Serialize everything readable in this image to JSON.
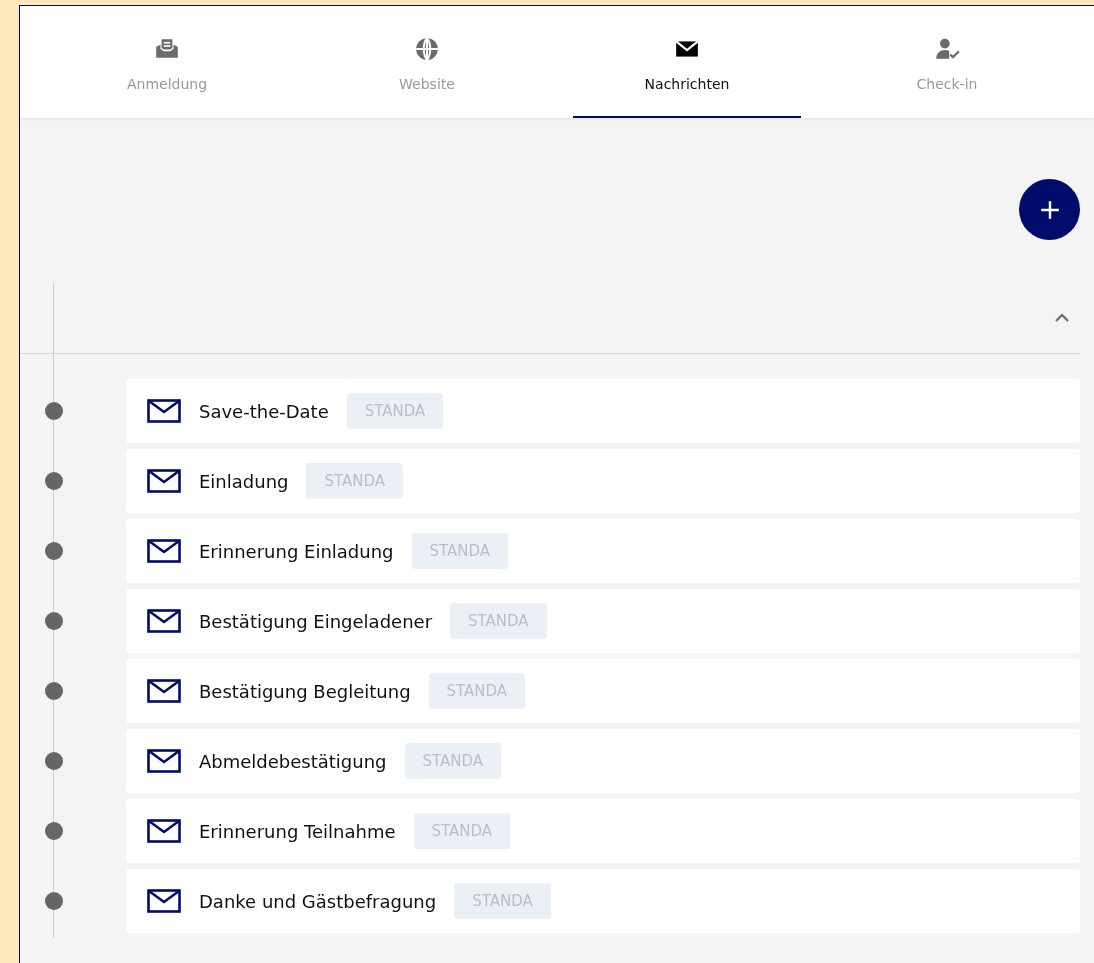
{
  "tabs": [
    {
      "label": "Anmeldung",
      "selected": false
    },
    {
      "label": "Website",
      "selected": false
    },
    {
      "label": "Nachrichten",
      "selected": true
    },
    {
      "label": "Check-in",
      "selected": false
    }
  ],
  "section": {
    "expanded": true
  },
  "messages": [
    {
      "title": "Save-the-Date",
      "badge": "STANDA"
    },
    {
      "title": "Einladung",
      "badge": "STANDA"
    },
    {
      "title": "Erinnerung Einladung",
      "badge": "STANDA"
    },
    {
      "title": "Bestätigung Eingeladener",
      "badge": "STANDA"
    },
    {
      "title": "Bestätigung Begleitung",
      "badge": "STANDA"
    },
    {
      "title": "Abmeldebestätigung",
      "badge": "STANDA"
    },
    {
      "title": "Erinnerung Teilnahme",
      "badge": "STANDA"
    },
    {
      "title": "Danke und Gästbefragung",
      "badge": "STANDA"
    }
  ]
}
